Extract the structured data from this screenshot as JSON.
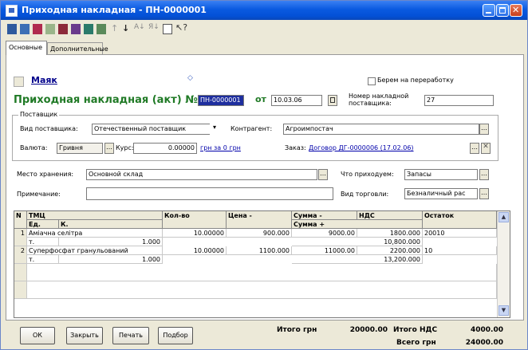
{
  "window": {
    "title": "Приходная накладная - ПН-0000001"
  },
  "tabs": [
    {
      "label": "Основные"
    },
    {
      "label": "Дополнительные"
    }
  ],
  "header": {
    "org_name": "Маяк",
    "reprocess_label": "Берем на переработку",
    "doc_title": "Приходная накладная (акт) №",
    "doc_number": "ПН-0000001",
    "date_label": "от",
    "date_value": "10.03.06",
    "supplier_num_label": "Номер накладной поставщика:",
    "supplier_num_value": "27"
  },
  "supplier": {
    "group_label": "Поставщик",
    "type_label": "Вид поставщика:",
    "type_value": "Отечественный поставщик",
    "counterparty_label": "Контрагент:",
    "counterparty_value": "Агроимпостач",
    "currency_label": "Валюта:",
    "currency_value": "Гривня",
    "rate_label": "Курс:",
    "rate_value": "0.00000",
    "rate_link": "грн за 0 грн",
    "order_label": "Заказ:",
    "order_link": "Договор ДГ-0000006 (17.02.06)"
  },
  "storage": {
    "place_label": "Место хранения:",
    "place_value": "Основной склад",
    "what_label": "Что приходуем:",
    "what_value": "Запасы",
    "note_label": "Примечание:",
    "note_value": "",
    "trade_label": "Вид торговли:",
    "trade_value": "Безналичный рас"
  },
  "table": {
    "headers": {
      "n": "N",
      "tmc": "ТМЦ",
      "unit": "Ед.",
      "k": "К.",
      "qty": "Кол-во",
      "price": "Цена -",
      "sum_minus": "Сумма -",
      "sum_plus": "Сумма +",
      "vat": "НДС",
      "rest": "Остаток"
    },
    "rows": [
      {
        "n": "1",
        "name": "Аміачна селітра",
        "unit": "т.",
        "k": "1.000",
        "qty": "10.00000",
        "price": "900.000",
        "sum": "9000.00",
        "vat": "1800.000",
        "sum_plus": "10,800.000",
        "rest": "20010"
      },
      {
        "n": "2",
        "name": "Суперфосфат гранульований",
        "unit": "т.",
        "k": "1.000",
        "qty": "10.00000",
        "price": "1100.000",
        "sum": "11000.00",
        "vat": "2200.000",
        "sum_plus": "13,200.000",
        "rest": "10"
      }
    ]
  },
  "buttons": {
    "ok": "ОК",
    "close": "Закрыть",
    "print": "Печать",
    "selection": "Подбор"
  },
  "totals": {
    "total_label": "Итого грн",
    "total_value": "20000.00",
    "vat_label": "Итого НДС",
    "vat_value": "4000.00",
    "grand_label": "Всего грн",
    "grand_value": "24000.00"
  }
}
